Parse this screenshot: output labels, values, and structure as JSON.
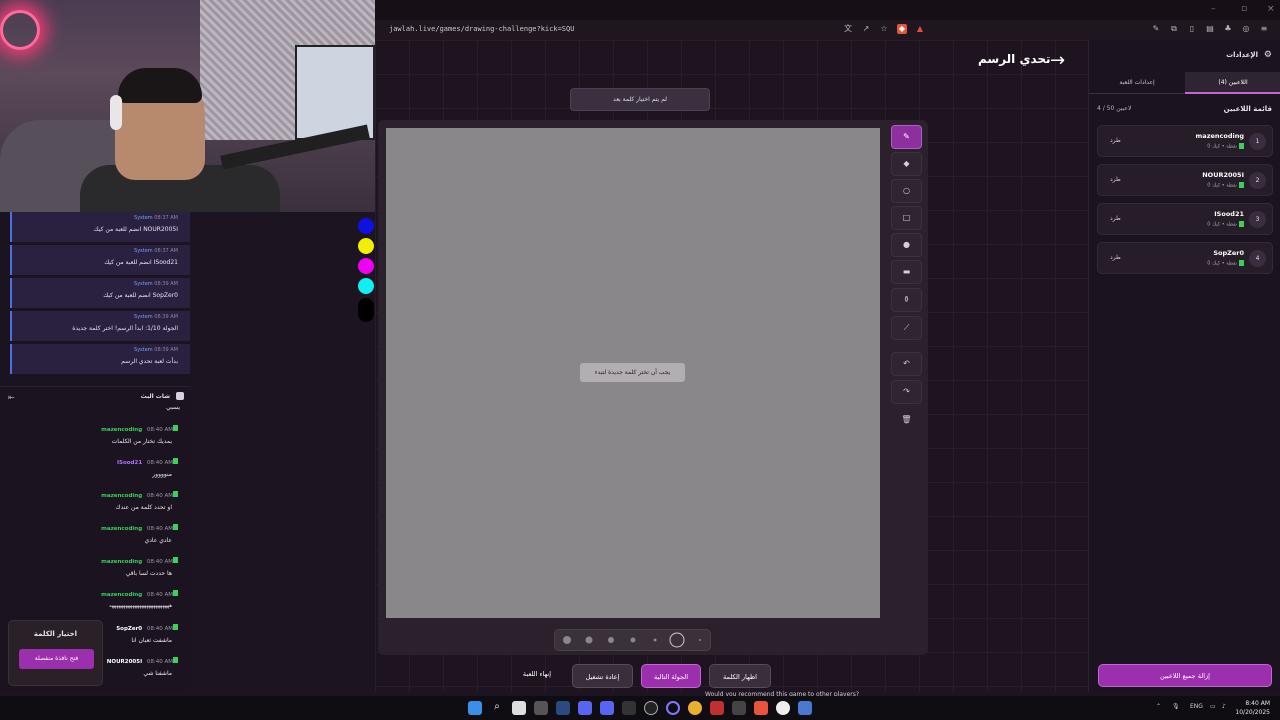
{
  "browser": {
    "url": "jawlah.live/games/drawing-challenge?kick=SQU",
    "notif_badge": "1"
  },
  "page": {
    "title": "تحدي الرسم",
    "word_banner": "لم يتم اختيار كلمة بعد",
    "canvas_message": "يجب أن تختر كلمة جديدة لتبدء",
    "colors": [
      "#1010e0",
      "#f0f000",
      "#f000f0",
      "#10f0f0",
      "#000000"
    ],
    "actions": {
      "show_word": "اظهار الكلمة",
      "next_round": "الجولة التالية",
      "restart": "إعادة تشغيل",
      "end_game": "إنهاء اللعبة"
    },
    "caption": "Would you recommend this game to other players?"
  },
  "sidebar": {
    "title": "الإعدادات",
    "tabs": {
      "players": "اللاعبين (4)",
      "settings": "إعدادات اللعبة"
    },
    "list_title": "قائمة اللاعبين",
    "count": "4 / 50 لاعبين",
    "kick_label": "طرد",
    "players": [
      {
        "num": "1",
        "name": "mazencoding",
        "sub": "0 نقطة • كيك"
      },
      {
        "num": "2",
        "name": "NOUR2005I",
        "sub": "0 نقطة • كيك"
      },
      {
        "num": "3",
        "name": "ISood21",
        "sub": "0 نقطة • كيك"
      },
      {
        "num": "4",
        "name": "SopZer0",
        "sub": "0 نقطة • كيك"
      }
    ],
    "kick_all": "إزالة جميع اللاعبين"
  },
  "system_messages": [
    {
      "time": "08:37 AM",
      "who": "System",
      "text": "NOUR2005I انضم للعبة من كيك"
    },
    {
      "time": "08:37 AM",
      "who": "System",
      "text": "ISood21 انضم للعبة من كيك"
    },
    {
      "time": "08:39 AM",
      "who": "System",
      "text": "SopZer0 انضم للعبة من كيك"
    },
    {
      "time": "08:39 AM",
      "who": "System",
      "text": "الجولة 1/10: ابدأ الرسم! اختر كلمة جديدة"
    },
    {
      "time": "08:39 AM",
      "who": "System",
      "text": "بدأت لعبة تحدي الرسم"
    }
  ],
  "chat": {
    "title": "شات البث",
    "top_fragment": "يسبي",
    "messages": [
      {
        "time": "08:40 AM",
        "user": "mazencoding",
        "color": "#3ad05a",
        "text": "يمديك تختار من الكلمات"
      },
      {
        "time": "08:40 AM",
        "user": "ISood21",
        "color": "#b070ff",
        "text": "منوووور"
      },
      {
        "time": "08:40 AM",
        "user": "mazencoding",
        "color": "#3ad05a",
        "text": "او تحدد كلمة من عندك"
      },
      {
        "time": "08:40 AM",
        "user": "mazencoding",
        "color": "#3ad05a",
        "text": "عادي عادي"
      },
      {
        "time": "08:40 AM",
        "user": "mazencoding",
        "color": "#3ad05a",
        "text": "ها حددت لسا باقي"
      },
      {
        "time": "08:40 AM",
        "user": "mazencoding",
        "color": "#3ad05a",
        "text": "ههههههههههههههههههههههههههه"
      },
      {
        "time": "08:40 AM",
        "user": "SopZer0",
        "color": "#ffffff",
        "text": "ماشفت ثعبان انا"
      },
      {
        "time": "08:40 AM",
        "user": "NOUR2005I",
        "color": "#ffffff",
        "text": "ماشفنا شي"
      }
    ],
    "popup_title": "اختيار الكلمة",
    "popup_button": "فتح نافذة منفصلة"
  },
  "taskbar": {
    "lang": "ENG",
    "time": "8:40 AM",
    "date": "10/20/2025"
  }
}
